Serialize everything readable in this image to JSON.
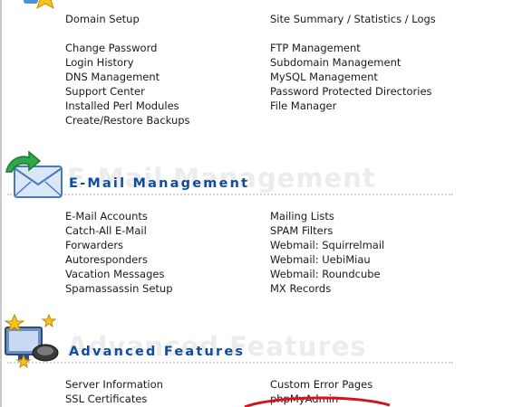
{
  "sections": {
    "email": {
      "title": "E-Mail Management",
      "shadow": "E-Mail Management"
    },
    "advanced": {
      "title": "Advanced Features",
      "shadow": "Advanced Features"
    }
  },
  "top_links": {
    "left": [
      "Domain Setup",
      "Change Password",
      "Login History",
      "DNS Management",
      "Support Center",
      "Installed Perl Modules",
      "Create/Restore Backups"
    ],
    "right": [
      "Site Summary / Statistics / Logs",
      "FTP Management",
      "Subdomain Management",
      "MySQL Management",
      "Password Protected Directories",
      "File Manager"
    ]
  },
  "email_links": {
    "left": [
      "E-Mail Accounts",
      "Catch-All E-Mail",
      "Forwarders",
      "Autoresponders",
      "Vacation Messages",
      "Spamassassin Setup"
    ],
    "right": [
      "Mailing Lists",
      "SPAM Filters",
      "Webmail: Squirrelmail",
      "Webmail: UebiMiau",
      "Webmail: Roundcube",
      "MX Records"
    ]
  },
  "advanced_links": {
    "left": [
      "Server Information",
      "SSL Certificates"
    ],
    "right": [
      "Custom Error Pages",
      "phpMyAdmin"
    ]
  },
  "colors": {
    "section_title": "#0f4d9c",
    "annotation_circle": "#d8121b"
  },
  "icons": {
    "top": "star-icon",
    "email": "email-envelope-icon",
    "advanced": "advanced-features-monitor-icon"
  }
}
